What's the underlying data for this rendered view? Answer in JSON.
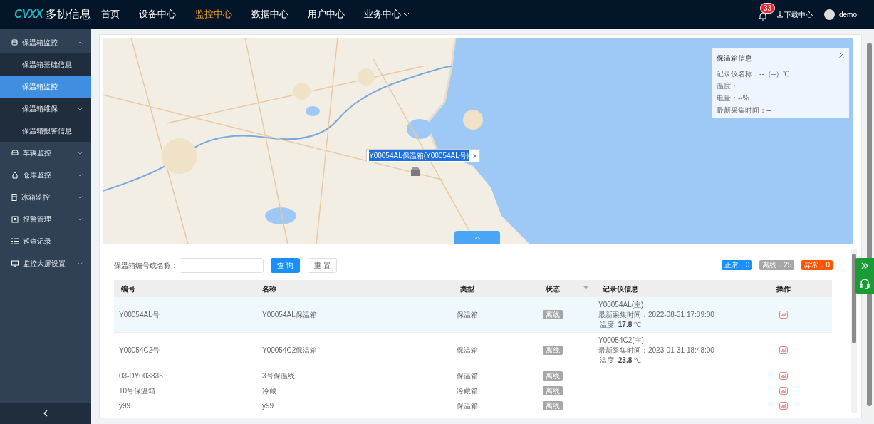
{
  "header": {
    "logo_mark": "CVXX",
    "logo_text": "多协信息",
    "nav": [
      {
        "label": "首页",
        "selected": false
      },
      {
        "label": "设备中心",
        "selected": false
      },
      {
        "label": "监控中心",
        "selected": true
      },
      {
        "label": "数据中心",
        "selected": false
      },
      {
        "label": "用户中心",
        "selected": false
      },
      {
        "label": "业务中心",
        "selected": false,
        "dropdown": true
      }
    ],
    "notifications": "33",
    "download": "下载中心",
    "user": "demo"
  },
  "sidebar": {
    "items": [
      {
        "label": "保温箱监控",
        "expanded": true,
        "children": [
          {
            "label": "保温箱基础信息",
            "selected": false
          },
          {
            "label": "保温箱监控",
            "selected": true
          },
          {
            "label": "保温箱维保",
            "selected": false,
            "expanded": false
          },
          {
            "label": "保温箱报警信息",
            "selected": false
          }
        ]
      },
      {
        "label": "车辆监控",
        "expanded": false
      },
      {
        "label": "仓库监控",
        "expanded": false
      },
      {
        "label": "冰箱监控",
        "expanded": false
      },
      {
        "label": "报警管理",
        "expanded": false
      },
      {
        "label": "巡查记录"
      },
      {
        "label": "监控大屏设置",
        "expanded": false
      }
    ]
  },
  "map": {
    "marker_label": "Y00054AL保温箱(Y00054AL号)",
    "info_panel": {
      "title": "保温箱信息",
      "lines": [
        "记录仪名称：--（--）℃",
        "温度：",
        "电量：--%",
        "最新采集时间：--"
      ]
    }
  },
  "search": {
    "label": "保温箱编号或名称：",
    "query_button": "查 询",
    "reset_button": "重 置"
  },
  "status_counts": [
    {
      "label": "正常：0",
      "color": "#1890ff"
    },
    {
      "label": "离线：25",
      "color": "#a6a6a6"
    },
    {
      "label": "异常：0",
      "color": "#ff5500"
    }
  ],
  "table": {
    "columns": [
      "编号",
      "名称",
      "类型",
      "状态",
      "记录仪信息",
      "操作"
    ],
    "rows": [
      {
        "id": "Y00054AL号",
        "name": "Y00054AL保温箱",
        "type": "保温箱",
        "status": "离线",
        "selected": true,
        "recorder": {
          "name": "Y00054AL(主)",
          "time": "最新采集时间：2022-08-31 17:39:00",
          "temp_label": "温度:",
          "temp": "17.8",
          "unit": "℃"
        }
      },
      {
        "id": "Y00054C2号",
        "name": "Y00054C2保温箱",
        "type": "保温箱",
        "status": "离线",
        "selected": false,
        "recorder": {
          "name": "Y00054C2(主)",
          "time": "最新采集时间：2023-01-31 18:48:00",
          "temp_label": "温度:",
          "temp": "23.8",
          "unit": "℃"
        }
      },
      {
        "id": "03-DY003836",
        "name": "3号保温线",
        "type": "保温箱",
        "status": "离线",
        "selected": false
      },
      {
        "id": "10号保温箱",
        "name": "冷藏",
        "type": "冷藏箱",
        "status": "离线",
        "selected": false
      },
      {
        "id": "y99",
        "name": "y99",
        "type": "保温箱",
        "status": "离线",
        "selected": false
      }
    ]
  }
}
